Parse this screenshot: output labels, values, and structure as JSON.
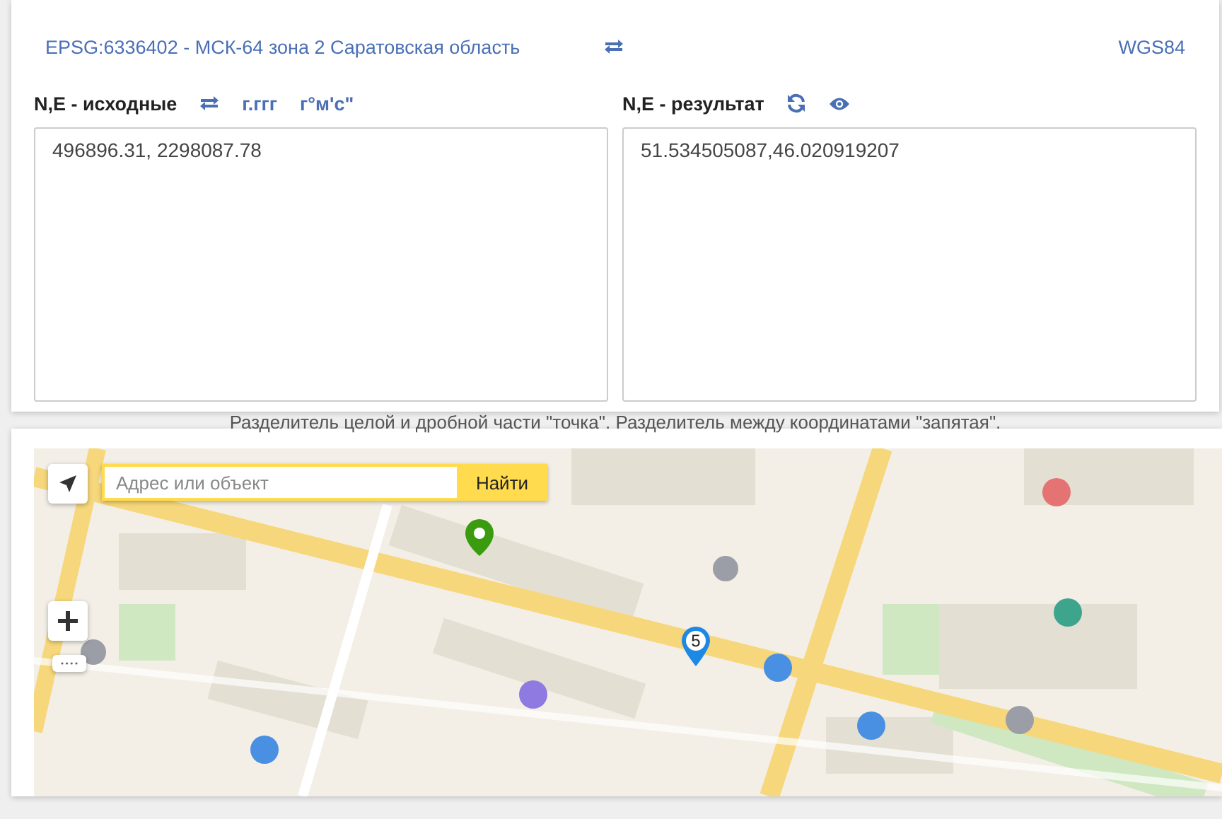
{
  "conversion": {
    "source_crs": "EPSG:6336402 - МСК-64 зона 2 Саратовская область",
    "target_crs": "WGS84"
  },
  "source": {
    "label": "N,E - исходные",
    "formats": [
      "г.ггг",
      "г°м'с\""
    ],
    "value": "496896.31, 2298087.78"
  },
  "result": {
    "label": "N,E - результат",
    "value": "51.534505087,46.020919207"
  },
  "hint": "Разделитель целой и дробной части \"точка\". Разделитель между координатами \"запятая\".",
  "map": {
    "search": {
      "placeholder": "Адрес или объект",
      "button": "Найти"
    },
    "placemark": "5"
  }
}
